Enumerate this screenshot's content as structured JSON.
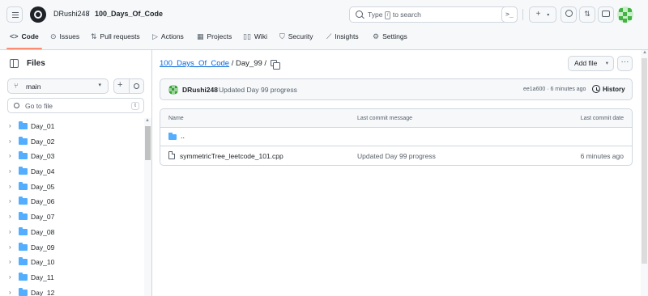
{
  "header": {
    "owner": "DRushi248",
    "separator": "/",
    "repo": "100_Days_Of_Code",
    "search_prefix": "Type ",
    "search_key": "/",
    "search_suffix": " to search",
    "command_palette": ">_",
    "new_button": "+",
    "new_caret": "▾"
  },
  "nav": {
    "tabs": [
      {
        "label": "Code",
        "icon": "code-icon"
      },
      {
        "label": "Issues",
        "icon": "issue-icon"
      },
      {
        "label": "Pull requests",
        "icon": "pull-request-icon"
      },
      {
        "label": "Actions",
        "icon": "play-icon"
      },
      {
        "label": "Projects",
        "icon": "table-icon"
      },
      {
        "label": "Wiki",
        "icon": "book-icon"
      },
      {
        "label": "Security",
        "icon": "shield-icon"
      },
      {
        "label": "Insights",
        "icon": "graph-icon"
      },
      {
        "label": "Settings",
        "icon": "gear-icon"
      }
    ]
  },
  "sidebar": {
    "title": "Files",
    "branch": "main",
    "goto_placeholder": "Go to file",
    "goto_key": "t",
    "tree": [
      "Day_01",
      "Day_02",
      "Day_03",
      "Day_04",
      "Day_05",
      "Day_06",
      "Day_07",
      "Day_08",
      "Day_09",
      "Day_10",
      "Day_11",
      "Day_12"
    ]
  },
  "main": {
    "path_repo": "100_Days_Of_Code",
    "path_sep1": " / ",
    "path_folder": "Day_99",
    "path_sep2": " /",
    "add_file": "Add file",
    "more": "···",
    "commit": {
      "user": "DRushi248",
      "message": "Updated Day 99 progress",
      "meta": "ee1a600 · 6 minutes ago",
      "history": "History"
    },
    "table": {
      "headers": {
        "name": "Name",
        "message": "Last commit message",
        "date": "Last commit date"
      },
      "parent": "..",
      "rows": [
        {
          "name": "symmetricTree_leetcode_101.cpp",
          "message": "Updated Day 99 progress",
          "date": "6 minutes ago"
        }
      ]
    }
  },
  "colors": {
    "accent": "#0969da",
    "tab_underline": "#fd8c73",
    "folder": "#54aeff",
    "border": "#d0d7de"
  }
}
